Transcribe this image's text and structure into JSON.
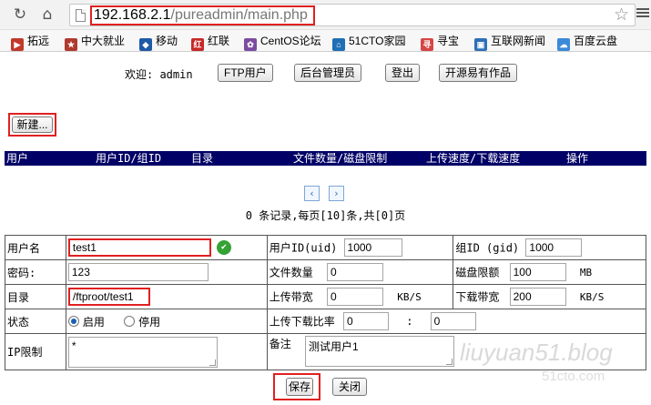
{
  "browser": {
    "url_host": "192.168.2.1",
    "url_path": "/pureadmin/main.php",
    "bookmarks": [
      {
        "label": "拓远",
        "color": "#c0392b"
      },
      {
        "label": "中大就业",
        "color": "#b03a2e"
      },
      {
        "label": "移动",
        "color": "#1f5aa6"
      },
      {
        "label": "红联",
        "color": "#c62828"
      },
      {
        "label": "CentOS论坛",
        "color": "#7b4ca0"
      },
      {
        "label": "51CTO家园",
        "color": "#1f6fb5"
      },
      {
        "label": "寻宝",
        "color": "#d64545"
      },
      {
        "label": "互联网新闻",
        "color": "#2e6fb8"
      },
      {
        "label": "百度云盘",
        "color": "#3b8ad9"
      }
    ]
  },
  "nav": {
    "welcome": "欢迎: admin",
    "buttons": [
      "FTP用户",
      "后台管理员",
      "登出",
      "开源易有作品"
    ]
  },
  "toolbar": {
    "new_label": "新建..."
  },
  "table_header": [
    "用户",
    "用户ID/组ID",
    "目录",
    "文件数量/磁盘限制",
    "上传速度/下载速度",
    "操作"
  ],
  "pager": {
    "prev": "‹",
    "next": "›",
    "info": "0 条记录,每页[10]条,共[0]页"
  },
  "form": {
    "username_label": "用户名",
    "username": "test1",
    "uid_label": "用户ID(uid)",
    "uid": "1000",
    "gid_label": "组ID (gid)",
    "gid": "1000",
    "password_label": "密码:",
    "password": "123",
    "files_label": "文件数量",
    "files": "0",
    "quota_label": "磁盘限额",
    "quota": "100",
    "quota_unit": "MB",
    "dir_label": "目录",
    "dir": "/ftproot/test1",
    "upload_label": "上传带宽",
    "upload": "0",
    "upload_unit": "KB/S",
    "download_label": "下载带宽",
    "download": "200",
    "download_unit": "KB/S",
    "status_label": "状态",
    "status_on": "启用",
    "status_off": "停用",
    "ratio_label": "上传下载比率",
    "ratio_up": "0",
    "ratio_sep": ":",
    "ratio_down": "0",
    "ip_label": "IP限制",
    "ip": "*",
    "note_label": "备注",
    "note": "测试用户1",
    "save_label": "保存",
    "close_label": "关闭"
  },
  "watermark": {
    "line1": "liuyuan51.blog",
    "line2": "51cto.com"
  }
}
